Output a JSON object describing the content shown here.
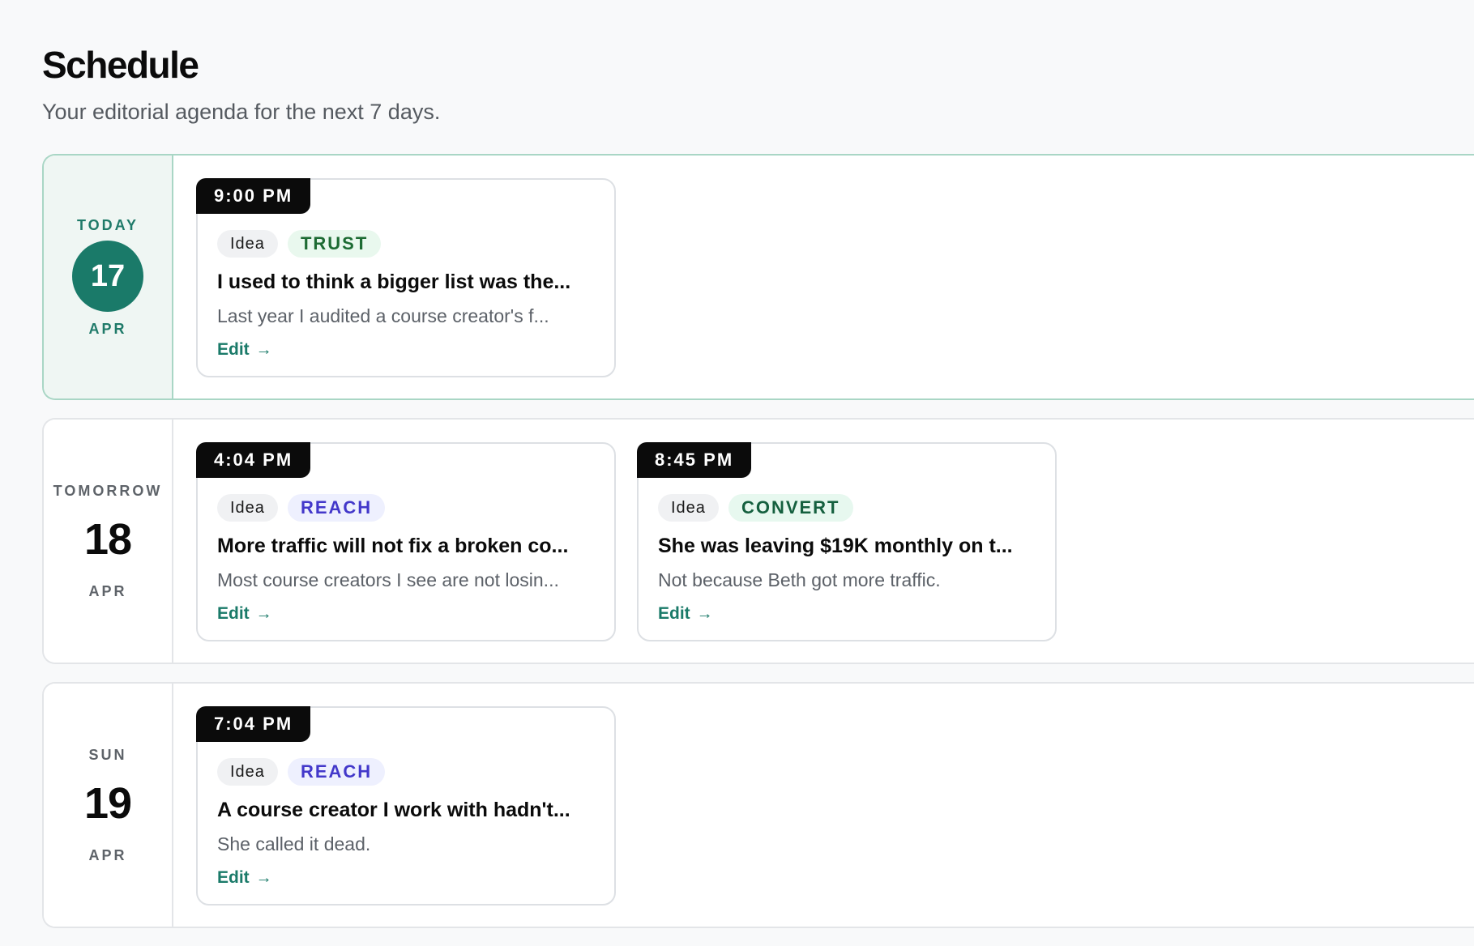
{
  "header": {
    "title": "Schedule",
    "subtitle": "Your editorial agenda for the next 7 days."
  },
  "colors": {
    "accent": "#1a7a69",
    "trust_text": "#1d6b33",
    "trust_bg": "#e9f8ee",
    "reach_text": "#4338ca",
    "reach_bg": "#eef0fe",
    "convert_text": "#15603f",
    "convert_bg": "#e7f8ef"
  },
  "days": [
    {
      "label": "TODAY",
      "day": "17",
      "month": "APR",
      "is_today": true,
      "items": [
        {
          "time": "9:00 PM",
          "type": "Idea",
          "category": "TRUST",
          "title": "I used to think a bigger list was the...",
          "excerpt": "Last year I audited a course creator's f...",
          "edit_label": "Edit",
          "edit_icon": "arrow-right-icon"
        }
      ]
    },
    {
      "label": "TOMORROW",
      "day": "18",
      "month": "APR",
      "is_today": false,
      "items": [
        {
          "time": "4:04 PM",
          "type": "Idea",
          "category": "REACH",
          "title": "More traffic will not fix a broken co...",
          "excerpt": "Most course creators I see are not losin...",
          "edit_label": "Edit",
          "edit_icon": "arrow-right-icon"
        },
        {
          "time": "8:45 PM",
          "type": "Idea",
          "category": "CONVERT",
          "title": "She was leaving $19K monthly on t...",
          "excerpt": "Not because Beth got more traffic.",
          "edit_label": "Edit",
          "edit_icon": "arrow-right-icon"
        }
      ]
    },
    {
      "label": "SUN",
      "day": "19",
      "month": "APR",
      "is_today": false,
      "items": [
        {
          "time": "7:04 PM",
          "type": "Idea",
          "category": "REACH",
          "title": "A course creator I work with hadn't...",
          "excerpt": "She called it dead.",
          "edit_label": "Edit",
          "edit_icon": "arrow-right-icon"
        }
      ]
    }
  ]
}
